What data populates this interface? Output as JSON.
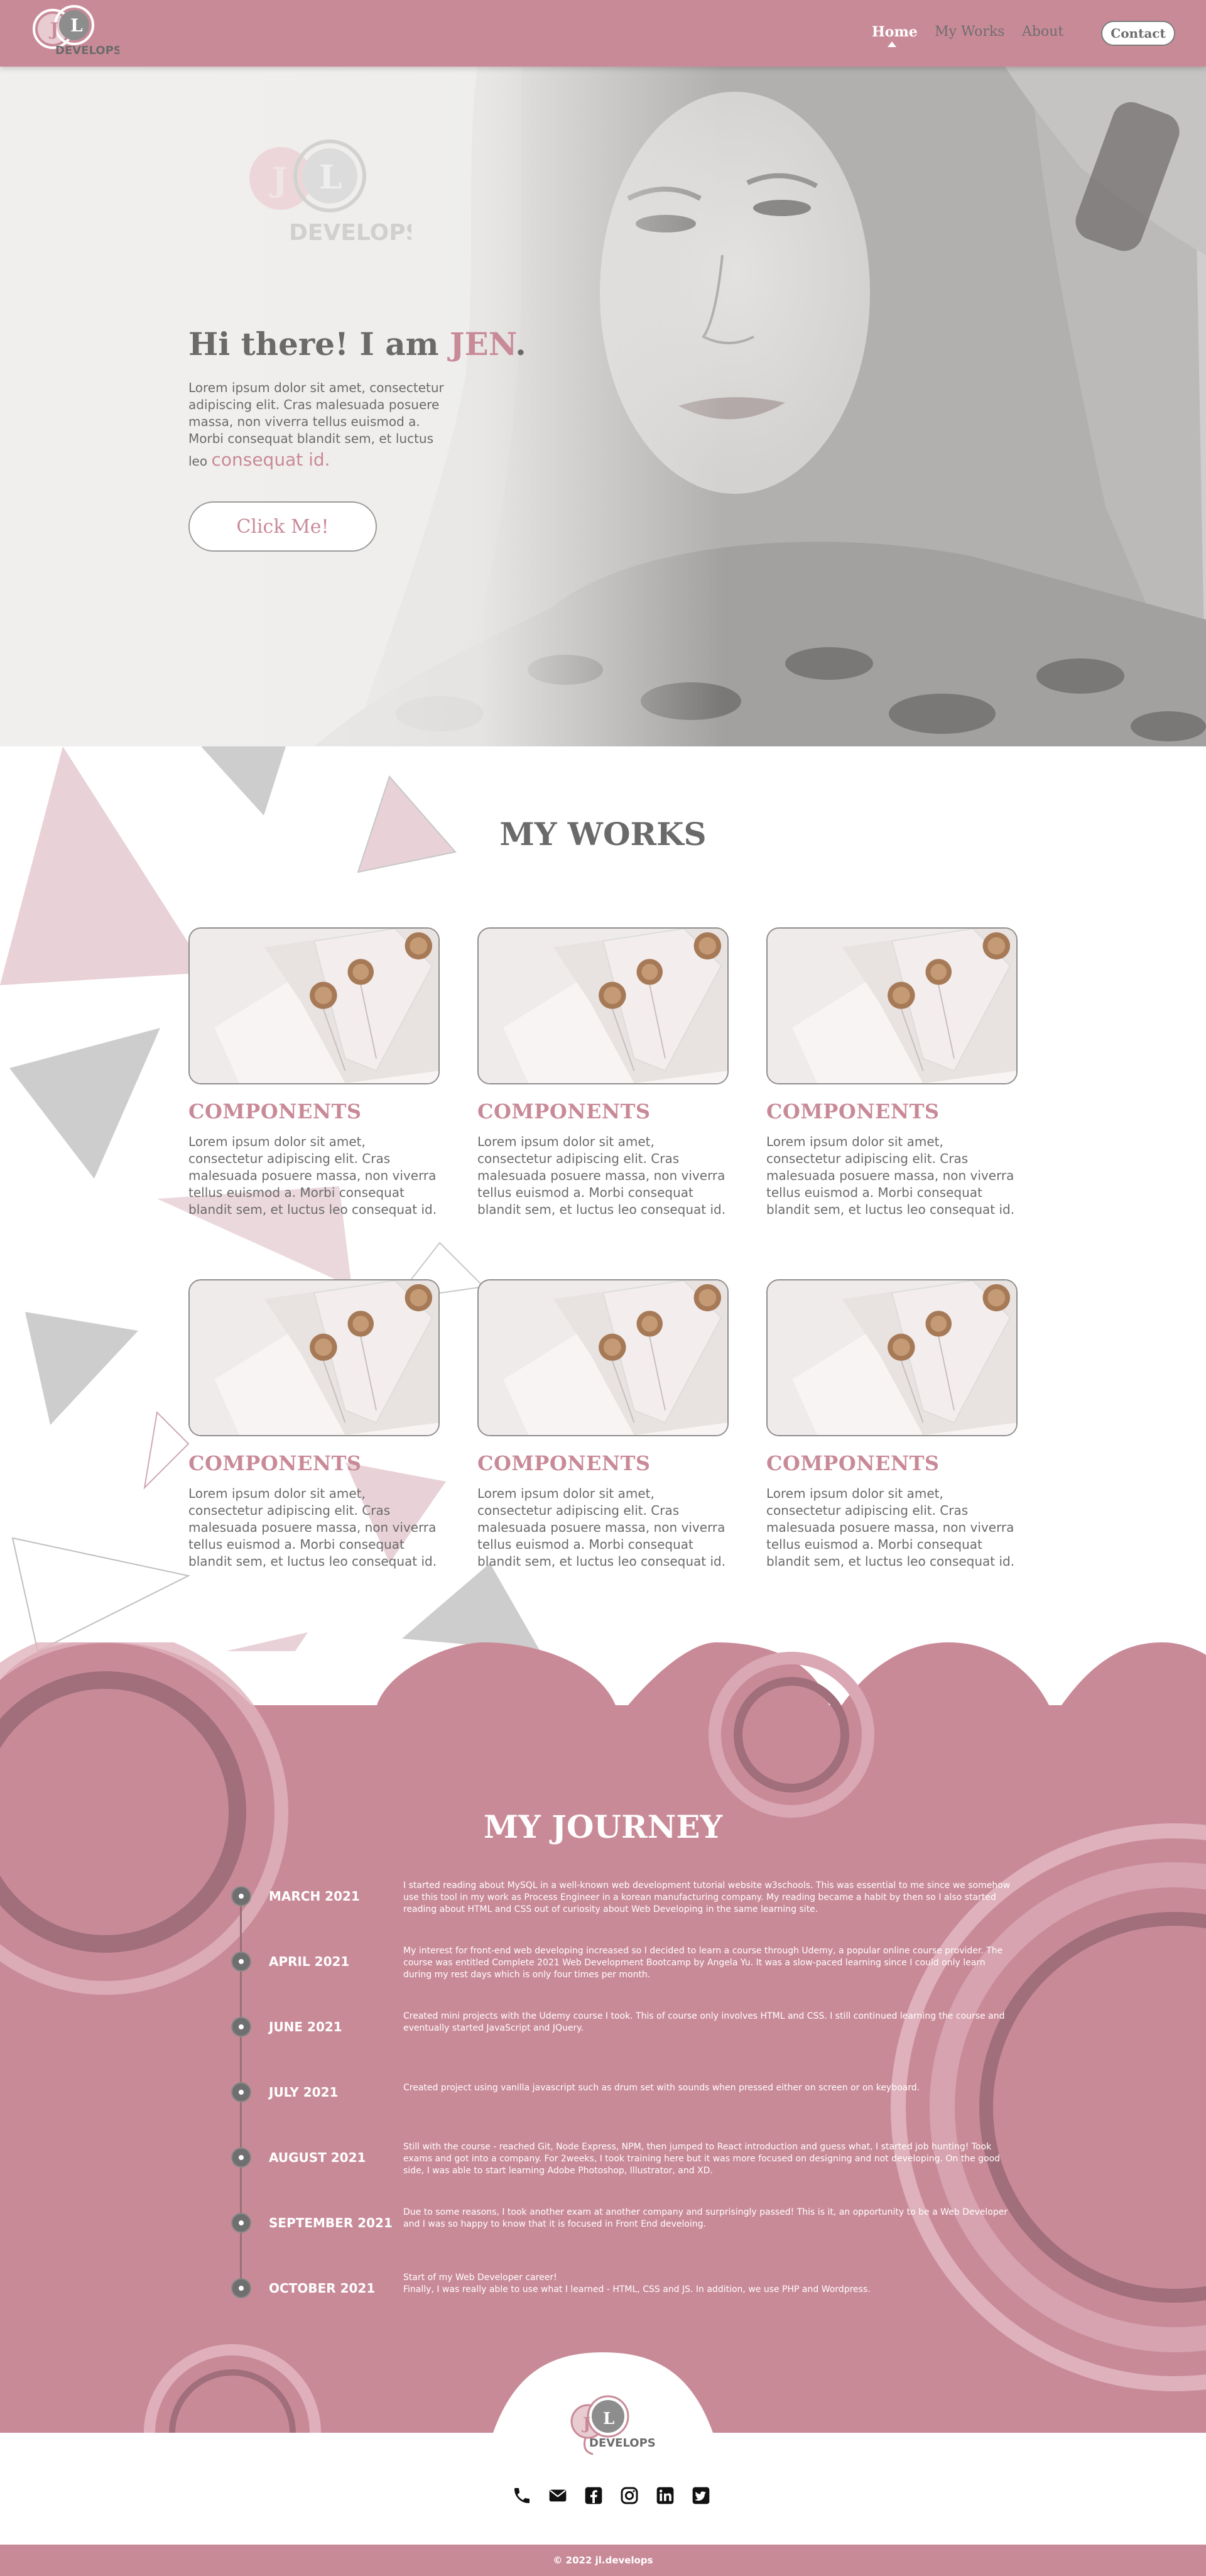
{
  "nav": {
    "logo_text": "DEVELOPS",
    "logo_letters": [
      "J",
      "L"
    ],
    "links": [
      {
        "label": "Home",
        "active": true
      },
      {
        "label": "My Works",
        "active": false
      },
      {
        "label": "About",
        "active": false
      }
    ],
    "contact_label": "Contact"
  },
  "hero": {
    "logo_text": "DEVELOPS",
    "logo_letters": [
      "J",
      "L"
    ],
    "title_prefix": "Hi there! I am ",
    "title_name": "JEN",
    "title_suffix": ".",
    "text": "Lorem ipsum dolor sit amet, consectetur adipiscing elit. Cras malesuada posuere massa, non viverra tellus euismod a. Morbi consequat blandit sem, et luctus leo",
    "text_accent": "consequat id.",
    "button_label": "Click Me!"
  },
  "works": {
    "title": "MY WORKS",
    "cards": [
      {
        "title": "COMPONENTS",
        "text": "Lorem ipsum dolor sit amet, consectetur adipiscing elit. Cras malesuada posuere massa, non viverra tellus euismod a. Morbi consequat blandit sem, et luctus leo consequat id."
      },
      {
        "title": "COMPONENTS",
        "text": "Lorem ipsum dolor sit amet, consectetur adipiscing elit. Cras malesuada posuere massa, non viverra tellus euismod a. Morbi consequat blandit sem, et luctus leo consequat id."
      },
      {
        "title": "COMPONENTS",
        "text": "Lorem ipsum dolor sit amet, consectetur adipiscing elit. Cras malesuada posuere massa, non viverra tellus euismod a. Morbi consequat blandit sem, et luctus leo consequat id."
      },
      {
        "title": "COMPONENTS",
        "text": "Lorem ipsum dolor sit amet, consectetur adipiscing elit. Cras malesuada posuere massa, non viverra tellus euismod a. Morbi consequat blandit sem, et luctus leo consequat id."
      },
      {
        "title": "COMPONENTS",
        "text": "Lorem ipsum dolor sit amet, consectetur adipiscing elit. Cras malesuada posuere massa, non viverra tellus euismod a. Morbi consequat blandit sem, et luctus leo consequat id."
      },
      {
        "title": "COMPONENTS",
        "text": "Lorem ipsum dolor sit amet, consectetur adipiscing elit. Cras malesuada posuere massa, non viverra tellus euismod a. Morbi consequat blandit sem, et luctus leo consequat id."
      }
    ]
  },
  "journey": {
    "title": "MY JOURNEY",
    "items": [
      {
        "date": "MARCH 2021",
        "text": "I started reading about MySQL in a well-known web development tutorial website w3schools. This was essential to me since we somehow use this tool in my work as Process Engineer in a korean manufacturing company. My reading became a habit by then so I also started reading about HTML and CSS out of curiosity about Web Developing in the same learning site."
      },
      {
        "date": "APRIL 2021",
        "text": "My interest for front-end web developing increased so I decided to learn a course through Udemy, a popular online course provider. The course was entitled Complete 2021 Web Development Bootcamp by Angela Yu. It was a slow-paced learning since I could only learn during my rest days which is only four times per month."
      },
      {
        "date": "JUNE 2021",
        "text": "Created mini projects with the Udemy course I took. This of course only involves HTML and CSS. I still continued learning the course and eventually started JavaScript and JQuery."
      },
      {
        "date": "JULY 2021",
        "text": "Created project using vanilla javascript such as drum set with sounds when pressed either on screen or on keyboard."
      },
      {
        "date": "AUGUST 2021",
        "text": "Still with the course - reached Git, Node Express, NPM, then jumped to React introduction and guess what, I started job hunting! Took exams and got into a company. For 2weeks, I took training here but it was more focused on designing and not developing. On the good side, I was able to start learning Adobe Photoshop, Illustrator, and XD."
      },
      {
        "date": "SEPTEMBER 2021",
        "text": "Due to some reasons, I took another exam at another company and surprisingly passed! This is it, an opportunity to be a Web Developer and I was so happy to know that it is focused in Front End develoing."
      },
      {
        "date": "OCTOBER 2021",
        "text": "Start of my Web Developer career!\nFinally, I was really able to use what I learned - HTML, CSS and JS. In addition, we use PHP and Wordpress."
      }
    ]
  },
  "footer": {
    "logo_text": "DEVELOPS",
    "logo_letters": [
      "J",
      "L"
    ],
    "social_icons": [
      "phone-icon",
      "email-icon",
      "facebook-icon",
      "instagram-icon",
      "linkedin-icon",
      "twitter-icon"
    ],
    "copyright": "© 2022 jl.develops"
  },
  "colors": {
    "accent": "#c98a98",
    "text": "#6a6a6a",
    "dark_circle": "#a06f7b",
    "light_triangle": "#e8d1d7",
    "gray_triangle": "#cdcdcd"
  }
}
